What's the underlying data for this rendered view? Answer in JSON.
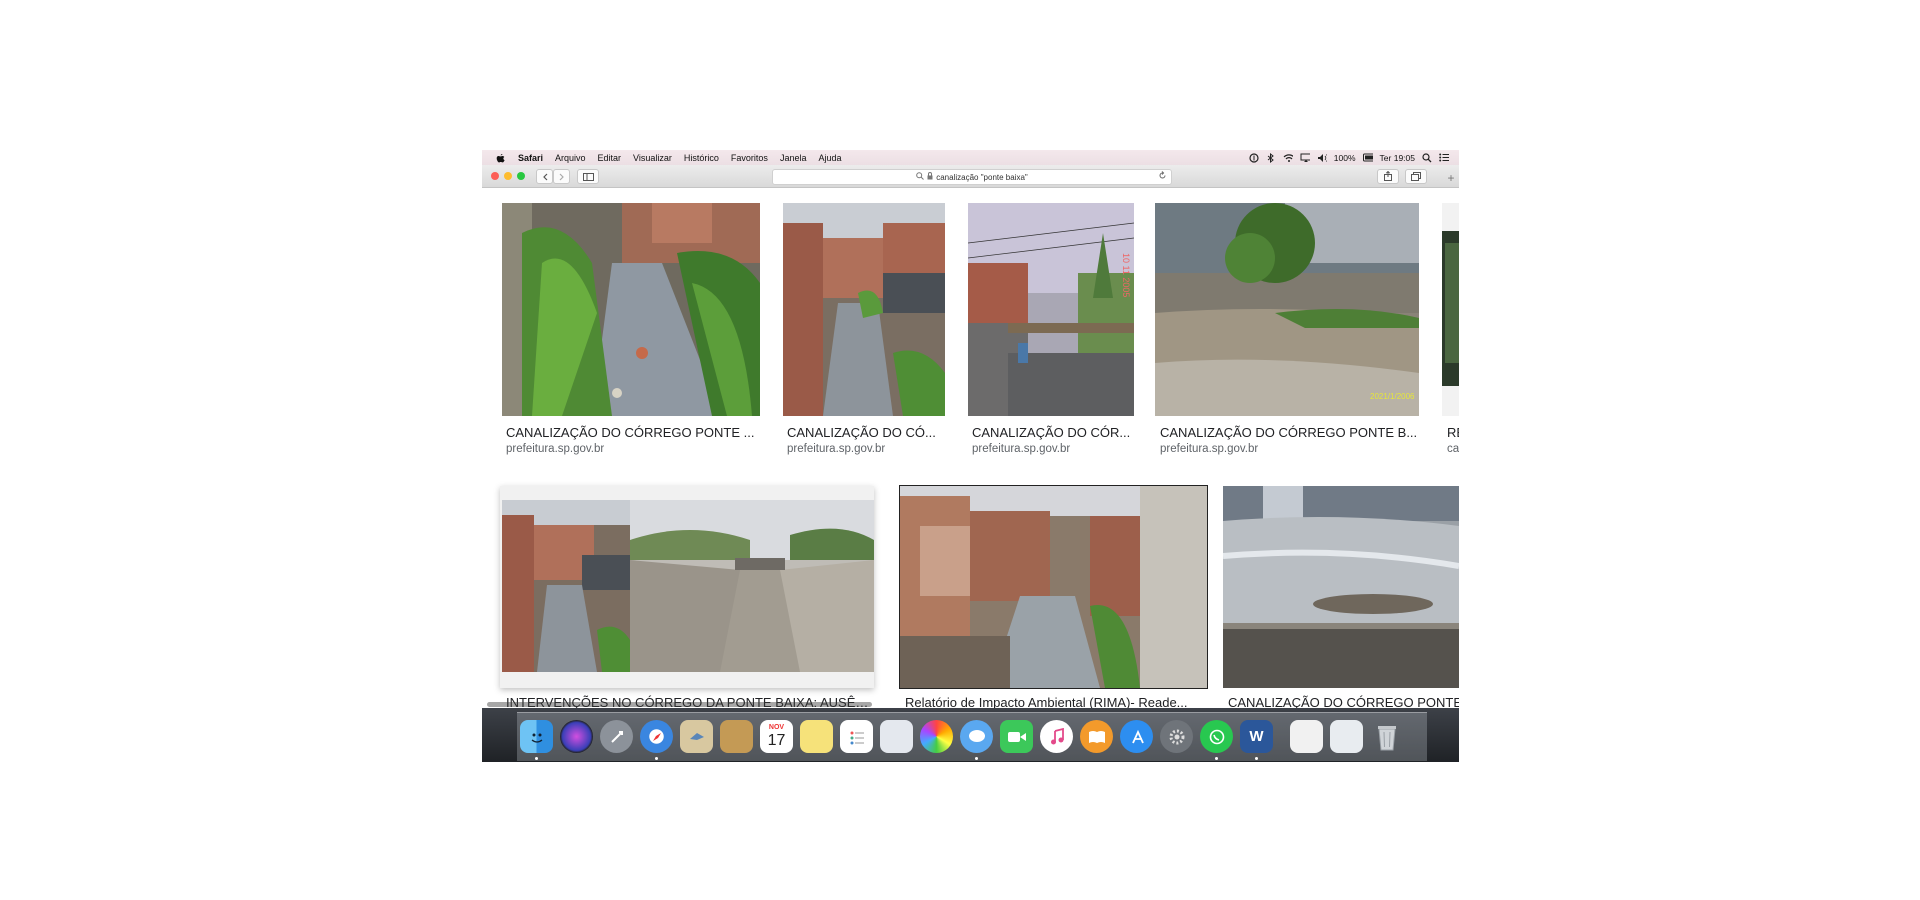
{
  "menubar": {
    "items": [
      "Safari",
      "Arquivo",
      "Editar",
      "Visualizar",
      "Histórico",
      "Favoritos",
      "Janela",
      "Ajuda"
    ],
    "battery": "100%",
    "clock": "Ter 19:05"
  },
  "toolbar": {
    "url": "canalização \"ponte baixa\""
  },
  "results_row1": [
    {
      "title": "CANALIZAÇÃO DO CÓRREGO PONTE ...",
      "source": "prefeitura.sp.gov.br"
    },
    {
      "title": "CANALIZAÇÃO DO CÓ...",
      "source": "prefeitura.sp.gov.br"
    },
    {
      "title": "CANALIZAÇÃO DO CÓR...",
      "source": "prefeitura.sp.gov.br"
    },
    {
      "title": "CANALIZAÇÃO DO CÓRREGO PONTE B...",
      "source": "prefeitura.sp.gov.br"
    },
    {
      "title": "RE",
      "source": "ca"
    }
  ],
  "results_row2": [
    {
      "title": "INTERVENÇÕES NO CÓRREGO DA PONTE BAIXA: AUSÊN..."
    },
    {
      "title": "Relatório de Impacto Ambiental (RIMA)- Reade..."
    },
    {
      "title": "CANALIZAÇÃO DO CÓRREGO PONTE..."
    }
  ],
  "dock": {
    "calendar_month": "NOV",
    "calendar_day": "17"
  }
}
